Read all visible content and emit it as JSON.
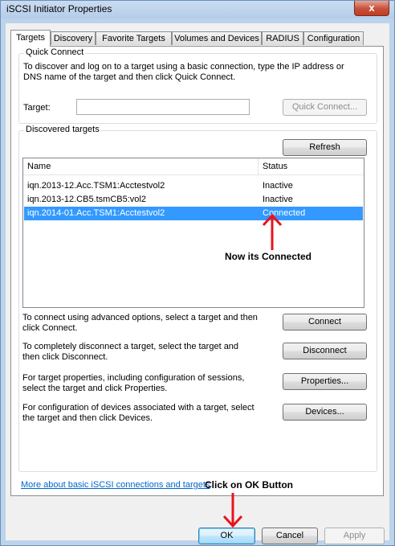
{
  "window": {
    "title": "iSCSI Initiator Properties",
    "close_glyph": "x"
  },
  "tabs": [
    {
      "label": "Targets",
      "active": true
    },
    {
      "label": "Discovery"
    },
    {
      "label": "Favorite Targets"
    },
    {
      "label": "Volumes and Devices"
    },
    {
      "label": "RADIUS"
    },
    {
      "label": "Configuration"
    }
  ],
  "quick_connect": {
    "legend": "Quick Connect",
    "description_line1": "To discover and log on to a target using a basic connection, type the IP address or",
    "description_line2": "DNS name of the target and then click Quick Connect.",
    "target_label": "Target:",
    "target_value": "",
    "button_label": "Quick Connect..."
  },
  "discovered": {
    "legend": "Discovered targets",
    "refresh_label": "Refresh",
    "columns": [
      "Name",
      "Status"
    ],
    "rows": [
      {
        "name": "iqn.2013-12.Acc.TSM1:Acctestvol2",
        "status": "Inactive"
      },
      {
        "name": "iqn.2013-12.CB5.tsmCB5:vol2",
        "status": "Inactive"
      },
      {
        "name": "iqn.2014-01.Acc.TSM1:Acctestvol2",
        "status": "Connected",
        "selected": true
      }
    ],
    "actions": [
      {
        "line1": "To connect using advanced options, select a target and then",
        "line2": "click Connect.",
        "button": "Connect"
      },
      {
        "line1": "To completely disconnect a target, select the target and",
        "line2": "then click Disconnect.",
        "button": "Disconnect"
      },
      {
        "line1": "For target properties, including configuration of sessions,",
        "line2": "select the target and click Properties.",
        "button": "Properties..."
      },
      {
        "line1": "For configuration of devices associated with a target, select",
        "line2": "the target and then click Devices.",
        "button": "Devices..."
      }
    ]
  },
  "help_link": "More about basic iSCSI connections and targets",
  "annotations": {
    "connected_note": "Now its Connected",
    "ok_note": "Click on OK Button",
    "arrow_color": "#e8141c"
  },
  "footer": {
    "ok": "OK",
    "cancel": "Cancel",
    "apply": "Apply"
  }
}
